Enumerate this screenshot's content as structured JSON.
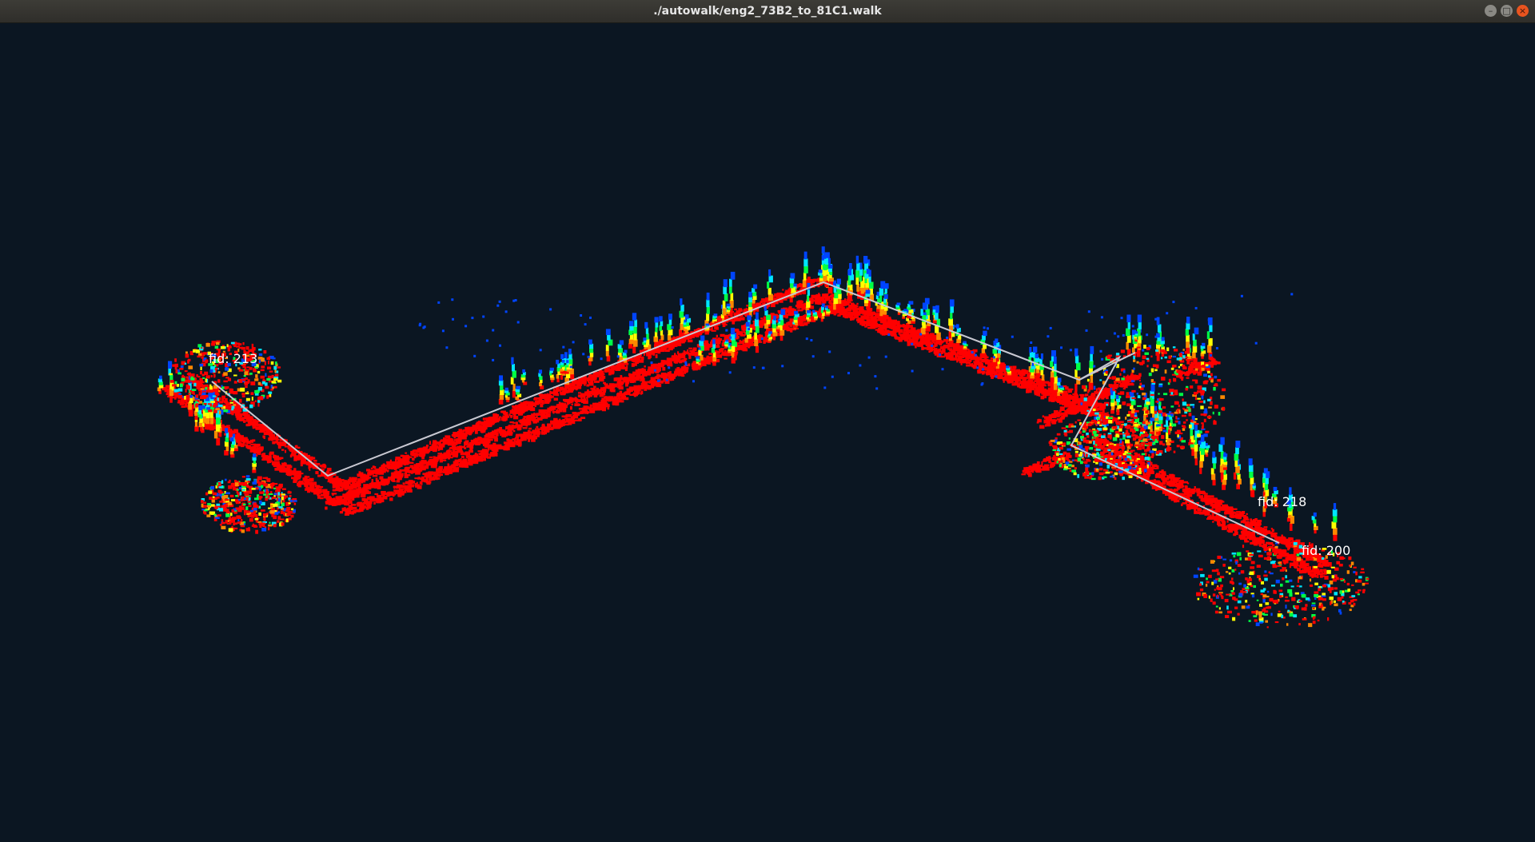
{
  "window": {
    "title": "./autowalk/eng2_73B2_to_81C1.walk",
    "controls": {
      "minimize": "–",
      "maximize": "□",
      "close": "×"
    }
  },
  "scene": {
    "background": "#0b1622",
    "path_color": "#c9c9d2",
    "cloud_colors": [
      "#ff0000",
      "#ff8800",
      "#ffff00",
      "#00ff44",
      "#00e5ff",
      "#0044ff"
    ],
    "fiducials": [
      {
        "label": "fid: 213"
      },
      {
        "label": "fid: 218"
      },
      {
        "label": "fid: 200"
      }
    ]
  }
}
